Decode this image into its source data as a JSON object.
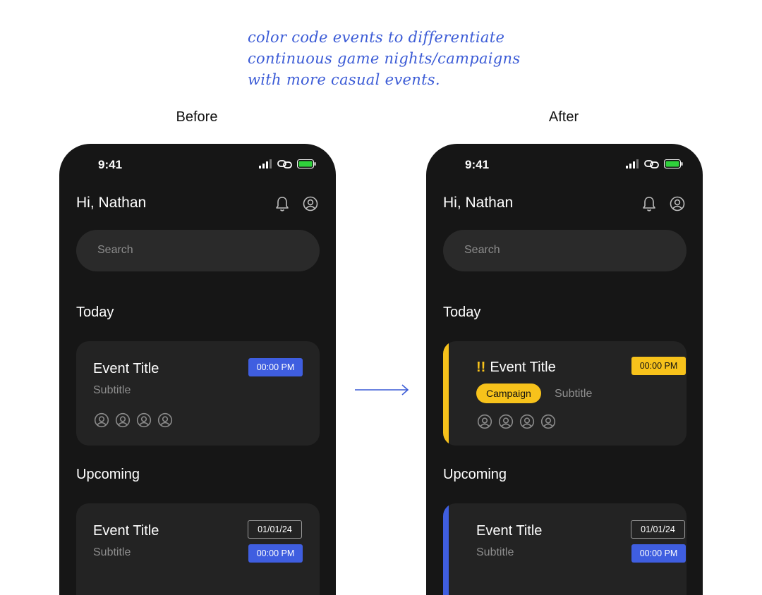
{
  "annotation": {
    "lines": [
      "color code events to differentiate",
      "continuous game nights/campaigns",
      "with more casual events."
    ]
  },
  "labels": {
    "before": "Before",
    "after": "After"
  },
  "colors": {
    "accent_blue": "#3f5ee0",
    "campaign_yellow": "#f7c21b",
    "phone_bg": "#161616",
    "card_bg": "#232323"
  },
  "before": {
    "status": {
      "time": "9:41"
    },
    "header": {
      "greeting": "Hi, Nathan"
    },
    "search": {
      "placeholder": "Search"
    },
    "today": {
      "section_title": "Today",
      "event": {
        "title": "Event Title",
        "subtitle": "Subtitle",
        "time": "00:00 PM"
      }
    },
    "upcoming": {
      "section_title": "Upcoming",
      "event": {
        "title": "Event Title",
        "subtitle": "Subtitle",
        "date": "01/01/24",
        "time": "00:00 PM"
      }
    }
  },
  "after": {
    "status": {
      "time": "9:41"
    },
    "header": {
      "greeting": "Hi, Nathan"
    },
    "search": {
      "placeholder": "Search"
    },
    "today": {
      "section_title": "Today",
      "event": {
        "priority_mark": "!!",
        "title": "Event Title",
        "tag": "Campaign",
        "subtitle": "Subtitle",
        "time": "00:00 PM"
      }
    },
    "upcoming": {
      "section_title": "Upcoming",
      "event": {
        "title": "Event Title",
        "subtitle": "Subtitle",
        "date": "01/01/24",
        "time": "00:00 PM"
      }
    }
  }
}
